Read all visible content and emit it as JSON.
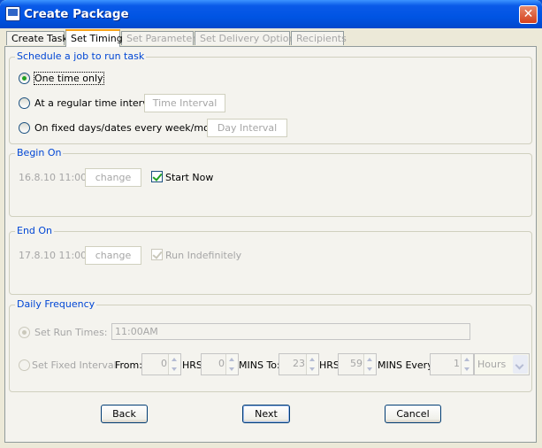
{
  "window": {
    "title": "Create Package"
  },
  "tabs": [
    {
      "label": "Create Task",
      "state": "normal"
    },
    {
      "label": "Set Timing",
      "state": "active"
    },
    {
      "label": "Set Parameters",
      "state": "disabled"
    },
    {
      "label": "Set Delivery Options",
      "state": "disabled"
    },
    {
      "label": "Recipients",
      "state": "disabled"
    }
  ],
  "schedule": {
    "title": "Schedule a job to run task",
    "one_time_label": "One time only",
    "regular_label": "At a regular time interval",
    "regular_button": "Time Interval",
    "fixed_label": "On fixed days/dates every week/month",
    "fixed_button": "Day Interval"
  },
  "begin_on": {
    "title": "Begin On",
    "date": "16.8.10 11:00",
    "change_label": "change",
    "start_now_label": "Start Now"
  },
  "end_on": {
    "title": "End On",
    "date": "17.8.10 11:00",
    "change_label": "change",
    "run_indef_label": "Run Indefinitely"
  },
  "daily": {
    "title": "Daily Frequency",
    "set_run_times_label": "Set Run Times:",
    "run_times_value": "11:00AM",
    "set_fixed_label": "Set Fixed Interval",
    "from_label": "From:",
    "from_hrs": "0",
    "hrs_label": "HRS",
    "from_mins": "0",
    "mins_to_label": "MINS To:",
    "to_hrs": "23",
    "hrs_label2": "HRS",
    "to_mins": "59",
    "mins_every_label": "MINS Every",
    "every_value": "1",
    "unit_value": "Hours"
  },
  "buttons": {
    "back": "Back",
    "next": "Next",
    "cancel": "Cancel"
  },
  "icons": {
    "close": "close-icon",
    "app": "app-icon"
  },
  "colors": {
    "titlebar": "#0054e3",
    "group_title": "#0046d5",
    "tab_accent": "#f9a31a",
    "check": "#21a121"
  }
}
